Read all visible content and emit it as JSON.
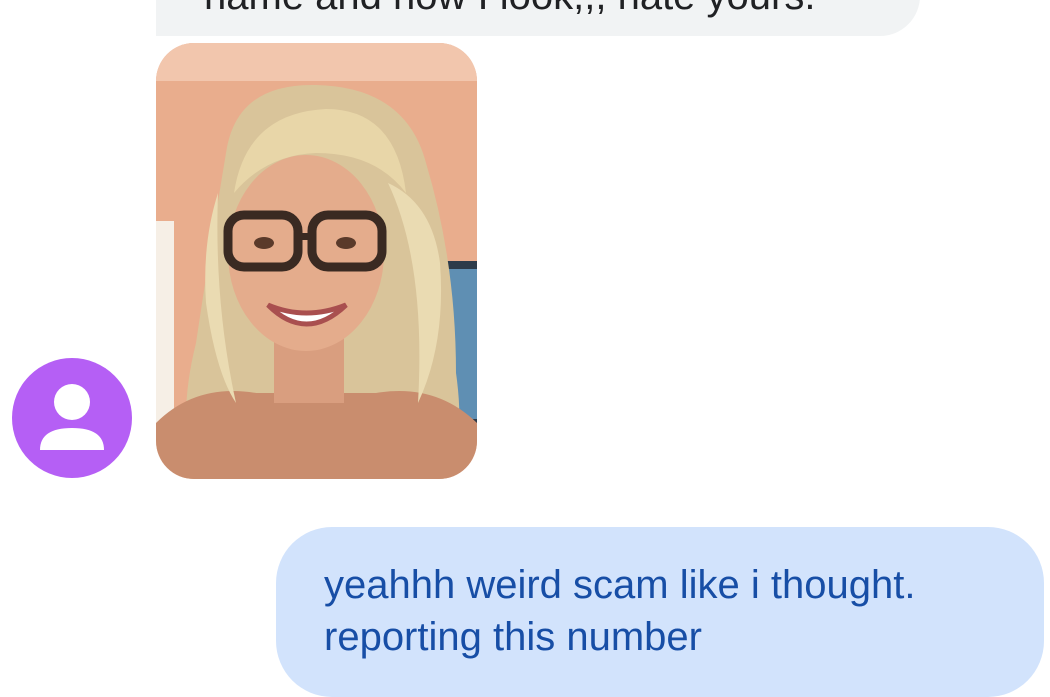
{
  "messages": {
    "incoming_partial": {
      "text": "name and how I look,,, hate yours."
    },
    "photo": {
      "description_icon": "photo-attachment"
    },
    "outgoing": {
      "line1": "yeahhh weird scam like i thought.",
      "line2": "reporting this number"
    }
  },
  "avatar": {
    "icon": "person-icon",
    "color": "#b55ff5"
  },
  "colors": {
    "incoming_bubble": "#f1f3f4",
    "outgoing_bubble": "#d2e3fc",
    "outgoing_text": "#174ea6",
    "incoming_text": "#202124"
  }
}
